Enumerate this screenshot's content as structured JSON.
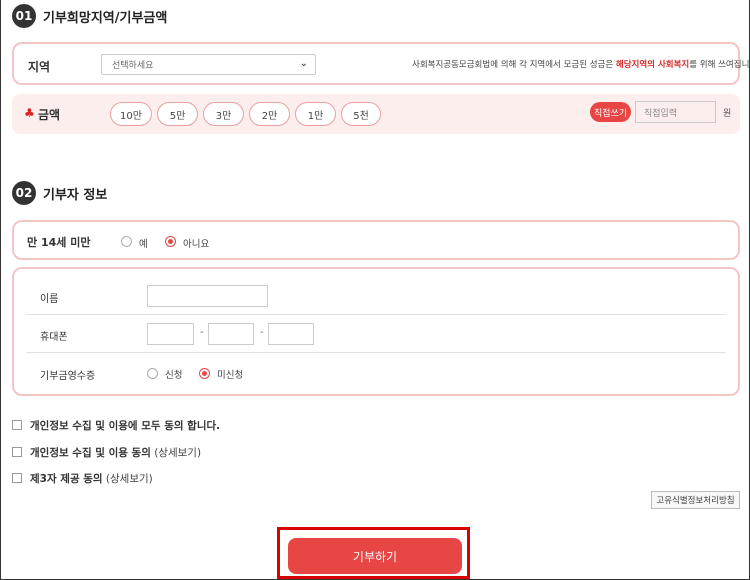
{
  "section1": {
    "number": "01",
    "title": "기부희망지역/기부금액",
    "region_label": "지역",
    "region_select": "선택하세요",
    "notice_pre": "사회복지공동모금회법에 의해 각 지역에서 모금된 성금은 ",
    "notice_highlight": "해당지역의 사회복지",
    "notice_post": "를 위해 쓰여집니다.",
    "amount_label": "금액",
    "amount_options": [
      "10만",
      "5만",
      "3만",
      "2만",
      "1만",
      "5천"
    ],
    "direct_button": "직접쓰기",
    "direct_placeholder": "직접입력",
    "currency_unit": "원"
  },
  "section2": {
    "number": "02",
    "title": "기부자 정보",
    "age_label": "만 14세 미만",
    "age_yes": "예",
    "age_no": "아니요",
    "name_label": "이름",
    "phone_label": "휴대폰",
    "phone_separator": "-",
    "receipt_label": "기부금영수증",
    "receipt_apply": "신청",
    "receipt_not_apply": "미신청"
  },
  "consents": {
    "all": "개인정보 수집 및 이용에 모두 동의 합니다.",
    "privacy": "개인정보 수집 및 이용 동의",
    "third_party": "제3자 제공 동의",
    "detail_link": "(상세보기)"
  },
  "policy_button": "고유식별정보처리방침",
  "submit_button": "기부하기",
  "colors": {
    "accent": "#e84545",
    "border_pink": "#f4c5c5",
    "band_pink": "#fdeeee",
    "highlight_red": "#d80000"
  }
}
